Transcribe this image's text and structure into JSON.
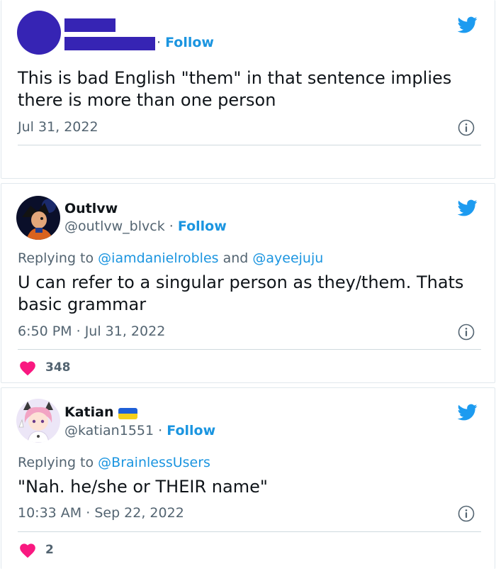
{
  "tweets": [
    {
      "name": "",
      "handle": "",
      "follow_label": "Follow",
      "separator": "·",
      "text": "This is bad English \"them\" in that sentence implies there is more than one person",
      "time": "",
      "date": "Jul 31, 2022"
    },
    {
      "name": "Outlvw",
      "handle": "@outlvw_blvck",
      "follow_label": "Follow",
      "separator": "·",
      "reply_prefix": "Replying to",
      "reply_mentions": [
        "@iamdanielrobles",
        "@ayeejuju"
      ],
      "reply_joiner": "and",
      "text": "U can refer to a singular person as they/them. Thats basic grammar",
      "time": "6:50 PM",
      "date": "Jul 31, 2022",
      "likes": "348"
    },
    {
      "name": "Katian",
      "handle": "@katian1551",
      "follow_label": "Follow",
      "separator": "·",
      "reply_prefix": "Replying to",
      "reply_mentions": [
        "@BrainlessUsers"
      ],
      "text": "\"Nah. he/she or THEIR name\"",
      "time": "10:33 AM",
      "date": "Sep 22, 2022",
      "likes": "2"
    }
  ],
  "colors": {
    "accent": "#1b95e0",
    "like": "#f91880",
    "redaction": "#3624b4",
    "muted": "#536471"
  },
  "icons": {
    "brand": "twitter-bird-icon",
    "info": "info-icon",
    "like": "heart-icon",
    "flag": "ukraine-flag-icon"
  }
}
